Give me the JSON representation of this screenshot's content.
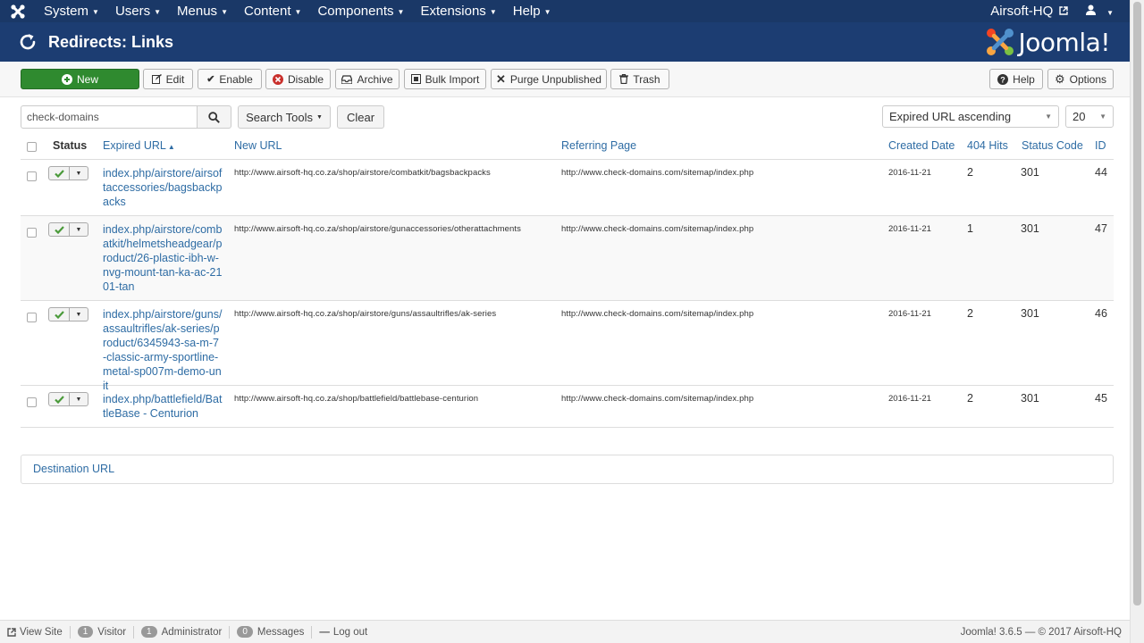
{
  "navbar": {
    "menu": [
      "System",
      "Users",
      "Menus",
      "Content",
      "Components",
      "Extensions",
      "Help"
    ],
    "site_name": "Airsoft-HQ"
  },
  "header": {
    "title": "Redirects: Links",
    "brand": "Joomla!"
  },
  "toolbar": {
    "new": "New",
    "edit": "Edit",
    "enable": "Enable",
    "disable": "Disable",
    "archive": "Archive",
    "bulk_import": "Bulk Import",
    "purge": "Purge Unpublished",
    "trash": "Trash",
    "help": "Help",
    "options": "Options"
  },
  "filters": {
    "search_value": "check-domains",
    "search_tools": "Search Tools",
    "clear": "Clear",
    "ordering": "Expired URL ascending",
    "limit": "20"
  },
  "table": {
    "headers": {
      "status": "Status",
      "expired_url": "Expired URL",
      "new_url": "New URL",
      "referring_page": "Referring Page",
      "created_date": "Created Date",
      "hits": "404 Hits",
      "status_code": "Status Code",
      "id": "ID"
    },
    "rows": [
      {
        "expired_url": "index.php/airstore/airsoftaccessories/bagsbackpacks",
        "new_url": "http://www.airsoft-hq.co.za/shop/airstore/combatkit/bagsbackpacks",
        "referring_page": "http://www.check-domains.com/sitemap/index.php",
        "created_date": "2016-11-21",
        "hits": "2",
        "status_code": "301",
        "id": "44"
      },
      {
        "expired_url": "index.php/airstore/combatkit/helmetsheadgear/product/26-plastic-ibh-w-nvg-mount-tan-ka-ac-2101-tan",
        "new_url": "http://www.airsoft-hq.co.za/shop/airstore/gunaccessories/otherattachments",
        "referring_page": "http://www.check-domains.com/sitemap/index.php",
        "created_date": "2016-11-21",
        "hits": "1",
        "status_code": "301",
        "id": "47"
      },
      {
        "expired_url": "index.php/airstore/guns/assaultrifles/ak-series/product/6345943-sa-m-7-classic-army-sportline-metal-sp007m-demo-unit",
        "new_url": "http://www.airsoft-hq.co.za/shop/airstore/guns/assaultrifles/ak-series",
        "referring_page": "http://www.check-domains.com/sitemap/index.php",
        "created_date": "2016-11-21",
        "hits": "2",
        "status_code": "301",
        "id": "46"
      },
      {
        "expired_url": "index.php/battlefield/BattleBase - Centurion",
        "new_url": "http://www.airsoft-hq.co.za/shop/battlefield/battlebase-centurion",
        "referring_page": "http://www.check-domains.com/sitemap/index.php",
        "created_date": "2016-11-21",
        "hits": "2",
        "status_code": "301",
        "id": "45"
      }
    ]
  },
  "destination": "Destination URL",
  "footer": {
    "view_site": "View Site",
    "visitor_count": "1",
    "visitor_label": "Visitor",
    "admin_count": "1",
    "admin_label": "Administrator",
    "messages_count": "0",
    "messages_label": "Messages",
    "logout": "Log out",
    "copyright": "Joomla! 3.6.5 — © 2017 Airsoft-HQ"
  },
  "colors": {
    "navbar_bg": "#1a3867",
    "header_bg": "#1c3d72",
    "link": "#2e6ca4",
    "new_button": "#2f8a2f",
    "status_check": "#4a9a3a"
  }
}
